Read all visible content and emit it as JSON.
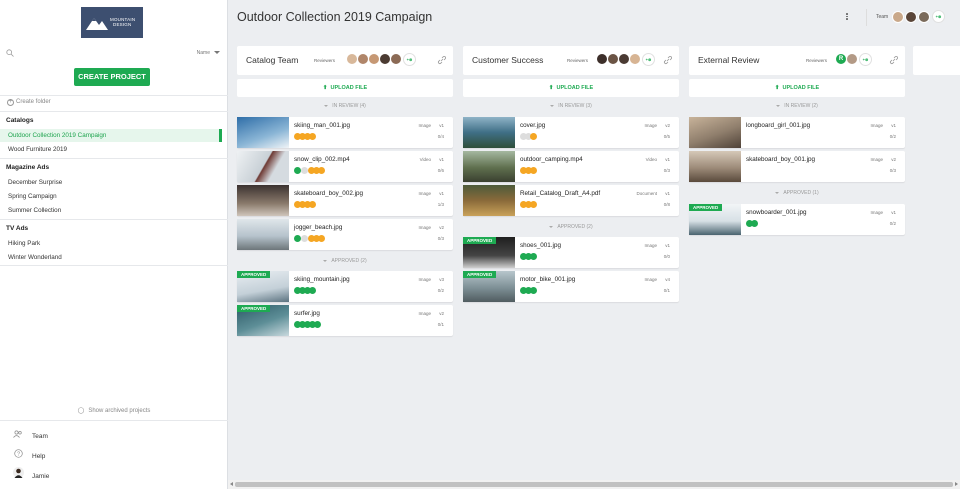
{
  "brand": {
    "line1": "MOUNTAIN",
    "line2": "DESIGN"
  },
  "search": {
    "placeholder": "",
    "sort_label": "Name"
  },
  "create_project_label": "CREATE PROJECT",
  "create_folder_label": "Create folder",
  "folders": [
    {
      "name": "Catalogs",
      "items": [
        "Outdoor Collection 2019 Campaign",
        "Wood Furniture 2019"
      ]
    },
    {
      "name": "Magazine Ads",
      "items": [
        "December Surprise",
        "Spring Campaign",
        "Summer Collection"
      ]
    },
    {
      "name": "TV Ads",
      "items": [
        "Hiking Park",
        "Winter Wonderland"
      ]
    }
  ],
  "active_project": "Outdoor Collection 2019 Campaign",
  "show_archived_label": "Show archived projects",
  "bottom_nav": [
    "Team",
    "Help",
    "Jamie"
  ],
  "header": {
    "title": "Outdoor Collection 2019 Campaign",
    "team_label": "Team"
  },
  "columns": [
    {
      "name": "Catalog Team",
      "reviewers_label": "Reviewers",
      "upload_label": "UPLOAD FILE",
      "in_review_label": "IN REVIEW (4)",
      "approved_label": "APPROVED (2)",
      "in_review": [
        {
          "file": "skiing_man_001.jpg",
          "type": "Image",
          "version": "v1",
          "count": "0/4",
          "steps": [
            "o",
            "o",
            "o",
            "o"
          ],
          "thumb": "#4a7aa8"
        },
        {
          "file": "snow_clip_002.mp4",
          "type": "Video",
          "version": "v1",
          "count": "0/6",
          "steps": [
            "g",
            "e",
            "o",
            "o",
            "o"
          ],
          "thumb": "#cfd6db"
        },
        {
          "file": "skateboard_boy_002.jpg",
          "type": "Image",
          "version": "v1",
          "count": "1/3",
          "steps": [
            "o",
            "o",
            "o",
            "o"
          ],
          "thumb": "#6b5e54"
        },
        {
          "file": "jogger_beach.jpg",
          "type": "Image",
          "version": "v2",
          "count": "0/3",
          "steps": [
            "g",
            "e",
            "o",
            "o",
            "o"
          ],
          "thumb": "#a9b9c6"
        }
      ],
      "approved": [
        {
          "file": "skiing_mountain.jpg",
          "type": "Image",
          "version": "v3",
          "count": "0/2",
          "steps": [
            "g",
            "g",
            "g",
            "g"
          ],
          "thumb": "#d9e2ea",
          "tag": "APPROVED"
        },
        {
          "file": "surfer.jpg",
          "type": "Image",
          "version": "v2",
          "count": "0/1",
          "steps": [
            "g",
            "g",
            "g",
            "g",
            "g"
          ],
          "thumb": "#4d7c8a",
          "tag": "APPROVED"
        }
      ]
    },
    {
      "name": "Customer Success",
      "reviewers_label": "Reviewers",
      "upload_label": "UPLOAD FILE",
      "in_review_label": "IN REVIEW (3)",
      "approved_label": "APPROVED (2)",
      "in_review": [
        {
          "file": "cover.jpg",
          "type": "Image",
          "version": "v2",
          "count": "0/5",
          "steps": [
            "e",
            "e",
            "o"
          ],
          "thumb": "#3f6f86"
        },
        {
          "file": "outdoor_camping.mp4",
          "type": "Video",
          "version": "v1",
          "count": "0/3",
          "steps": [
            "o",
            "o",
            "o"
          ],
          "thumb": "#5e6e4d"
        },
        {
          "file": "Retail_Catalog_Draft_A4.pdf",
          "type": "Document",
          "version": "v1",
          "count": "0/8",
          "steps": [
            "o",
            "o",
            "o"
          ],
          "thumb": "#8a7a5a"
        }
      ],
      "approved": [
        {
          "file": "shoes_001.jpg",
          "type": "Image",
          "version": "v1",
          "count": "0/0",
          "steps": [
            "g",
            "g",
            "g"
          ],
          "thumb": "#2d2d2d",
          "tag": "APPROVED"
        },
        {
          "file": "motor_bike_001.jpg",
          "type": "Image",
          "version": "v4",
          "count": "0/1",
          "steps": [
            "g",
            "g",
            "g"
          ],
          "thumb": "#7d8f95",
          "tag": "APPROVED"
        }
      ]
    },
    {
      "name": "External Review",
      "reviewers_label": "Reviewers",
      "upload_label": "UPLOAD FILE",
      "in_review_label": "IN REVIEW (2)",
      "approved_label": "APPROVED (1)",
      "in_review": [
        {
          "file": "longboard_girl_001.jpg",
          "type": "Image",
          "version": "v1",
          "count": "0/2",
          "steps": [],
          "thumb": "#8f7e6c"
        },
        {
          "file": "skateboard_boy_001.jpg",
          "type": "Image",
          "version": "v2",
          "count": "0/3",
          "steps": [],
          "thumb": "#9c8a78"
        }
      ],
      "approved": [
        {
          "file": "snowboarder_001.jpg",
          "type": "Image",
          "version": "v1",
          "count": "0/2",
          "steps": [
            "g",
            "g"
          ],
          "thumb": "#e6ecef",
          "tag": "APPROVED"
        }
      ]
    }
  ],
  "colors": {
    "accent": "#1eaa52",
    "pending": "#f5a623",
    "empty": "#dddddd",
    "brand": "#3d4f70"
  }
}
